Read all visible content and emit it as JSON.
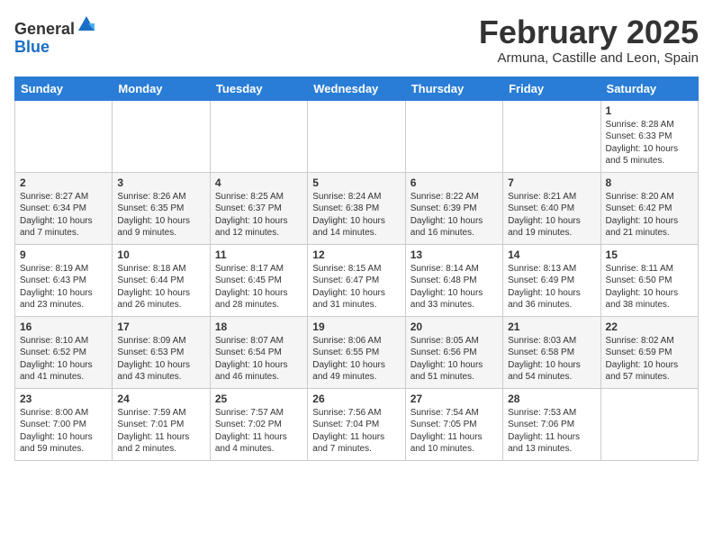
{
  "header": {
    "logo_general": "General",
    "logo_blue": "Blue",
    "month_title": "February 2025",
    "location": "Armuna, Castille and Leon, Spain"
  },
  "weekdays": [
    "Sunday",
    "Monday",
    "Tuesday",
    "Wednesday",
    "Thursday",
    "Friday",
    "Saturday"
  ],
  "weeks": [
    [
      {
        "day": "",
        "info": ""
      },
      {
        "day": "",
        "info": ""
      },
      {
        "day": "",
        "info": ""
      },
      {
        "day": "",
        "info": ""
      },
      {
        "day": "",
        "info": ""
      },
      {
        "day": "",
        "info": ""
      },
      {
        "day": "1",
        "info": "Sunrise: 8:28 AM\nSunset: 6:33 PM\nDaylight: 10 hours\nand 5 minutes."
      }
    ],
    [
      {
        "day": "2",
        "info": "Sunrise: 8:27 AM\nSunset: 6:34 PM\nDaylight: 10 hours\nand 7 minutes."
      },
      {
        "day": "3",
        "info": "Sunrise: 8:26 AM\nSunset: 6:35 PM\nDaylight: 10 hours\nand 9 minutes."
      },
      {
        "day": "4",
        "info": "Sunrise: 8:25 AM\nSunset: 6:37 PM\nDaylight: 10 hours\nand 12 minutes."
      },
      {
        "day": "5",
        "info": "Sunrise: 8:24 AM\nSunset: 6:38 PM\nDaylight: 10 hours\nand 14 minutes."
      },
      {
        "day": "6",
        "info": "Sunrise: 8:22 AM\nSunset: 6:39 PM\nDaylight: 10 hours\nand 16 minutes."
      },
      {
        "day": "7",
        "info": "Sunrise: 8:21 AM\nSunset: 6:40 PM\nDaylight: 10 hours\nand 19 minutes."
      },
      {
        "day": "8",
        "info": "Sunrise: 8:20 AM\nSunset: 6:42 PM\nDaylight: 10 hours\nand 21 minutes."
      }
    ],
    [
      {
        "day": "9",
        "info": "Sunrise: 8:19 AM\nSunset: 6:43 PM\nDaylight: 10 hours\nand 23 minutes."
      },
      {
        "day": "10",
        "info": "Sunrise: 8:18 AM\nSunset: 6:44 PM\nDaylight: 10 hours\nand 26 minutes."
      },
      {
        "day": "11",
        "info": "Sunrise: 8:17 AM\nSunset: 6:45 PM\nDaylight: 10 hours\nand 28 minutes."
      },
      {
        "day": "12",
        "info": "Sunrise: 8:15 AM\nSunset: 6:47 PM\nDaylight: 10 hours\nand 31 minutes."
      },
      {
        "day": "13",
        "info": "Sunrise: 8:14 AM\nSunset: 6:48 PM\nDaylight: 10 hours\nand 33 minutes."
      },
      {
        "day": "14",
        "info": "Sunrise: 8:13 AM\nSunset: 6:49 PM\nDaylight: 10 hours\nand 36 minutes."
      },
      {
        "day": "15",
        "info": "Sunrise: 8:11 AM\nSunset: 6:50 PM\nDaylight: 10 hours\nand 38 minutes."
      }
    ],
    [
      {
        "day": "16",
        "info": "Sunrise: 8:10 AM\nSunset: 6:52 PM\nDaylight: 10 hours\nand 41 minutes."
      },
      {
        "day": "17",
        "info": "Sunrise: 8:09 AM\nSunset: 6:53 PM\nDaylight: 10 hours\nand 43 minutes."
      },
      {
        "day": "18",
        "info": "Sunrise: 8:07 AM\nSunset: 6:54 PM\nDaylight: 10 hours\nand 46 minutes."
      },
      {
        "day": "19",
        "info": "Sunrise: 8:06 AM\nSunset: 6:55 PM\nDaylight: 10 hours\nand 49 minutes."
      },
      {
        "day": "20",
        "info": "Sunrise: 8:05 AM\nSunset: 6:56 PM\nDaylight: 10 hours\nand 51 minutes."
      },
      {
        "day": "21",
        "info": "Sunrise: 8:03 AM\nSunset: 6:58 PM\nDaylight: 10 hours\nand 54 minutes."
      },
      {
        "day": "22",
        "info": "Sunrise: 8:02 AM\nSunset: 6:59 PM\nDaylight: 10 hours\nand 57 minutes."
      }
    ],
    [
      {
        "day": "23",
        "info": "Sunrise: 8:00 AM\nSunset: 7:00 PM\nDaylight: 10 hours\nand 59 minutes."
      },
      {
        "day": "24",
        "info": "Sunrise: 7:59 AM\nSunset: 7:01 PM\nDaylight: 11 hours\nand 2 minutes."
      },
      {
        "day": "25",
        "info": "Sunrise: 7:57 AM\nSunset: 7:02 PM\nDaylight: 11 hours\nand 4 minutes."
      },
      {
        "day": "26",
        "info": "Sunrise: 7:56 AM\nSunset: 7:04 PM\nDaylight: 11 hours\nand 7 minutes."
      },
      {
        "day": "27",
        "info": "Sunrise: 7:54 AM\nSunset: 7:05 PM\nDaylight: 11 hours\nand 10 minutes."
      },
      {
        "day": "28",
        "info": "Sunrise: 7:53 AM\nSunset: 7:06 PM\nDaylight: 11 hours\nand 13 minutes."
      },
      {
        "day": "",
        "info": ""
      }
    ]
  ]
}
